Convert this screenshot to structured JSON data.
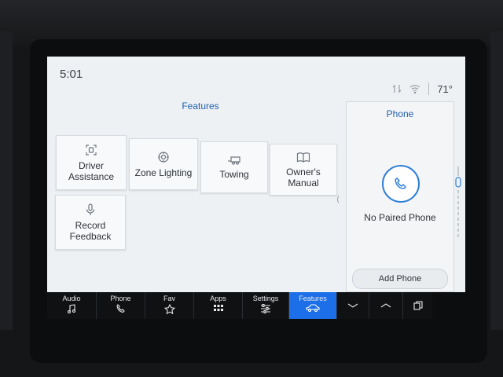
{
  "status": {
    "time": "5:01",
    "temperature": "71°"
  },
  "features": {
    "title": "Features",
    "tiles": [
      {
        "label1": "Driver",
        "label2": "Assistance",
        "icon": "driver-assistance-icon"
      },
      {
        "label1": "Zone Lighting",
        "label2": "",
        "icon": "zone-lighting-icon"
      },
      {
        "label1": "Towing",
        "label2": "",
        "icon": "towing-icon"
      },
      {
        "label1": "Owner's",
        "label2": "Manual",
        "icon": "owners-manual-icon"
      },
      {
        "label1": "Record",
        "label2": "Feedback",
        "icon": "microphone-icon"
      }
    ]
  },
  "phone_panel": {
    "title": "Phone",
    "status": "No Paired Phone",
    "add_label": "Add Phone"
  },
  "dock": {
    "items": [
      {
        "label": "Audio",
        "icon": "music-note-icon"
      },
      {
        "label": "Phone",
        "icon": "phone-icon"
      },
      {
        "label": "Fav",
        "icon": "star-icon"
      },
      {
        "label": "Apps",
        "icon": "apps-grid-icon"
      },
      {
        "label": "Settings",
        "icon": "sliders-icon"
      },
      {
        "label": "Features",
        "icon": "car-icon",
        "active": true
      }
    ]
  },
  "colors": {
    "accent": "#1c6fe8",
    "title_blue": "#1f5fae",
    "screen_bg": "#eef1f4"
  }
}
